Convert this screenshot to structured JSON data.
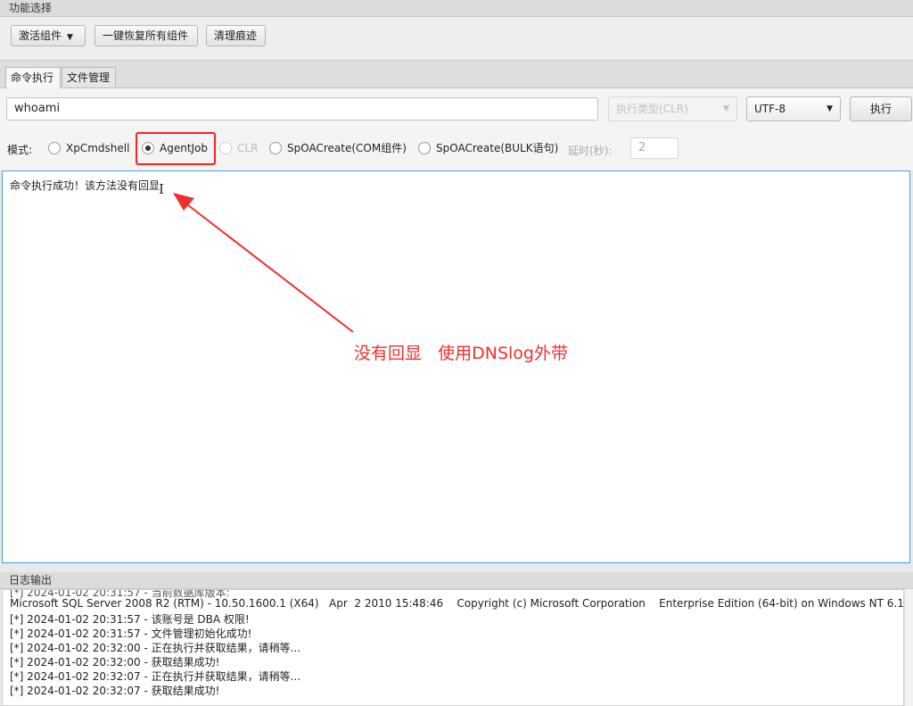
{
  "function_section": {
    "title": "功能选择"
  },
  "toolbar": {
    "activate_label": "激活组件",
    "restore_label": "一键恢复所有组件",
    "clean_label": "清理痕迹"
  },
  "tabs": [
    {
      "label": "命令执行",
      "active": true
    },
    {
      "label": "文件管理",
      "active": false
    }
  ],
  "command": {
    "value": "whoami",
    "exec_type": "执行类型(CLR)",
    "encoding": "UTF-8",
    "execute_label": "执行"
  },
  "modes": {
    "label": "模式:",
    "options": [
      {
        "label": "XpCmdshell",
        "checked": false,
        "enabled": true
      },
      {
        "label": "AgentJob",
        "checked": true,
        "enabled": true
      },
      {
        "label": "CLR",
        "checked": false,
        "enabled": false
      },
      {
        "label": "SpOACreate(COM组件)",
        "checked": false,
        "enabled": true
      },
      {
        "label": "SpOACreate(BULK语句)",
        "checked": false,
        "enabled": true
      }
    ],
    "delay_label": "延时(秒):",
    "delay_value": "2"
  },
  "output": {
    "text": "命令执行成功！该方法没有回显"
  },
  "annotation": {
    "text": "没有回显   使用DNSlog外带",
    "color": "#f03030"
  },
  "log": {
    "title": "日志输出",
    "lines": [
      "Microsoft SQL Server 2008 R2 (RTM) - 10.50.1600.1 (X64)   Apr  2 2010 15:48:46    Copyright (c) Microsoft Corporation    Enterprise Edition (64-bit) on Windows NT 6.1",
      "[*] 2024-01-02 20:31:57 - 该账号是 DBA 权限!",
      "[*] 2024-01-02 20:31:57 - 文件管理初始化成功!",
      "[*] 2024-01-02 20:32:00 - 正在执行并获取结果，请稍等...",
      "[*] 2024-01-02 20:32:00 - 获取结果成功!",
      "[*] 2024-01-02 20:32:07 - 正在执行并获取结果，请稍等...",
      "[*] 2024-01-02 20:32:07 - 获取结果成功!"
    ]
  }
}
